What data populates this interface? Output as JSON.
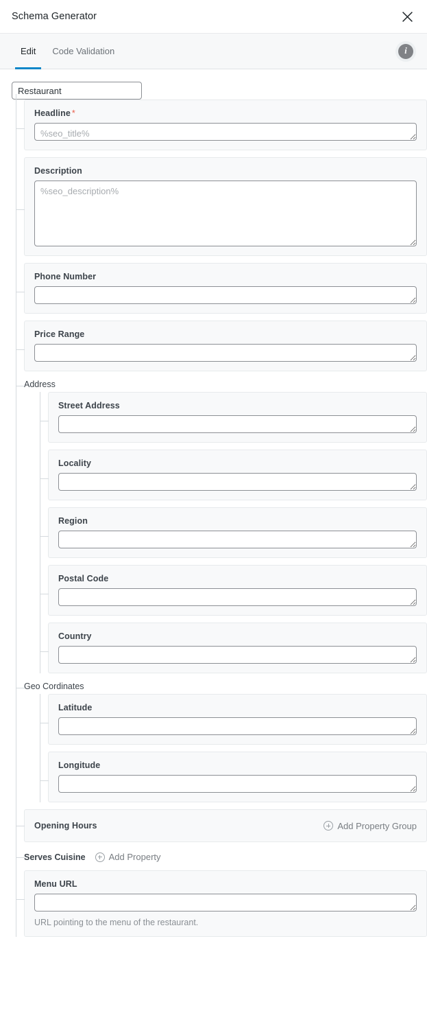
{
  "window": {
    "title": "Schema Generator",
    "close_icon": "close-icon"
  },
  "tabs": {
    "items": [
      {
        "label": "Edit",
        "active": true
      },
      {
        "label": "Code Validation",
        "active": false
      }
    ],
    "info_icon_glyph": "i",
    "active_underline_color": "#0b86c8"
  },
  "schema": {
    "type_value": "Restaurant",
    "required_marker": "*"
  },
  "fields": {
    "headline": {
      "label": "Headline",
      "required": true,
      "placeholder": "%seo_title%",
      "value": ""
    },
    "description": {
      "label": "Description",
      "required": false,
      "placeholder": "%seo_description%",
      "value": ""
    },
    "phone_number": {
      "label": "Phone Number",
      "required": false,
      "placeholder": "",
      "value": ""
    },
    "price_range": {
      "label": "Price Range",
      "required": false,
      "placeholder": "",
      "value": ""
    },
    "street_address": {
      "label": "Street Address",
      "required": false,
      "placeholder": "",
      "value": ""
    },
    "locality": {
      "label": "Locality",
      "required": false,
      "placeholder": "",
      "value": ""
    },
    "region": {
      "label": "Region",
      "required": false,
      "placeholder": "",
      "value": ""
    },
    "postal_code": {
      "label": "Postal Code",
      "required": false,
      "placeholder": "",
      "value": ""
    },
    "country": {
      "label": "Country",
      "required": false,
      "placeholder": "",
      "value": ""
    },
    "latitude": {
      "label": "Latitude",
      "required": false,
      "placeholder": "",
      "value": ""
    },
    "longitude": {
      "label": "Longitude",
      "required": false,
      "placeholder": "",
      "value": ""
    },
    "menu_url": {
      "label": "Menu URL",
      "required": false,
      "placeholder": "",
      "value": "",
      "helper": "URL pointing to the menu of the restaurant."
    }
  },
  "groups": {
    "address": {
      "label": "Address"
    },
    "geo_cordinates": {
      "label": "Geo Cordinates"
    },
    "opening_hours": {
      "label": "Opening Hours",
      "add_label": "Add Property Group",
      "add_icon": "plus-circle-icon"
    },
    "serves_cuisine": {
      "label": "Serves Cuisine",
      "add_label": "Add Property",
      "add_icon": "plus-circle-icon"
    }
  },
  "colors": {
    "accent": "#0b86c8",
    "required": "#e8604c",
    "card_bg": "#f8f9fa",
    "card_border": "#e7eaec",
    "tree_line": "#d5dade",
    "tabbar_bg": "#f7f8f9"
  }
}
